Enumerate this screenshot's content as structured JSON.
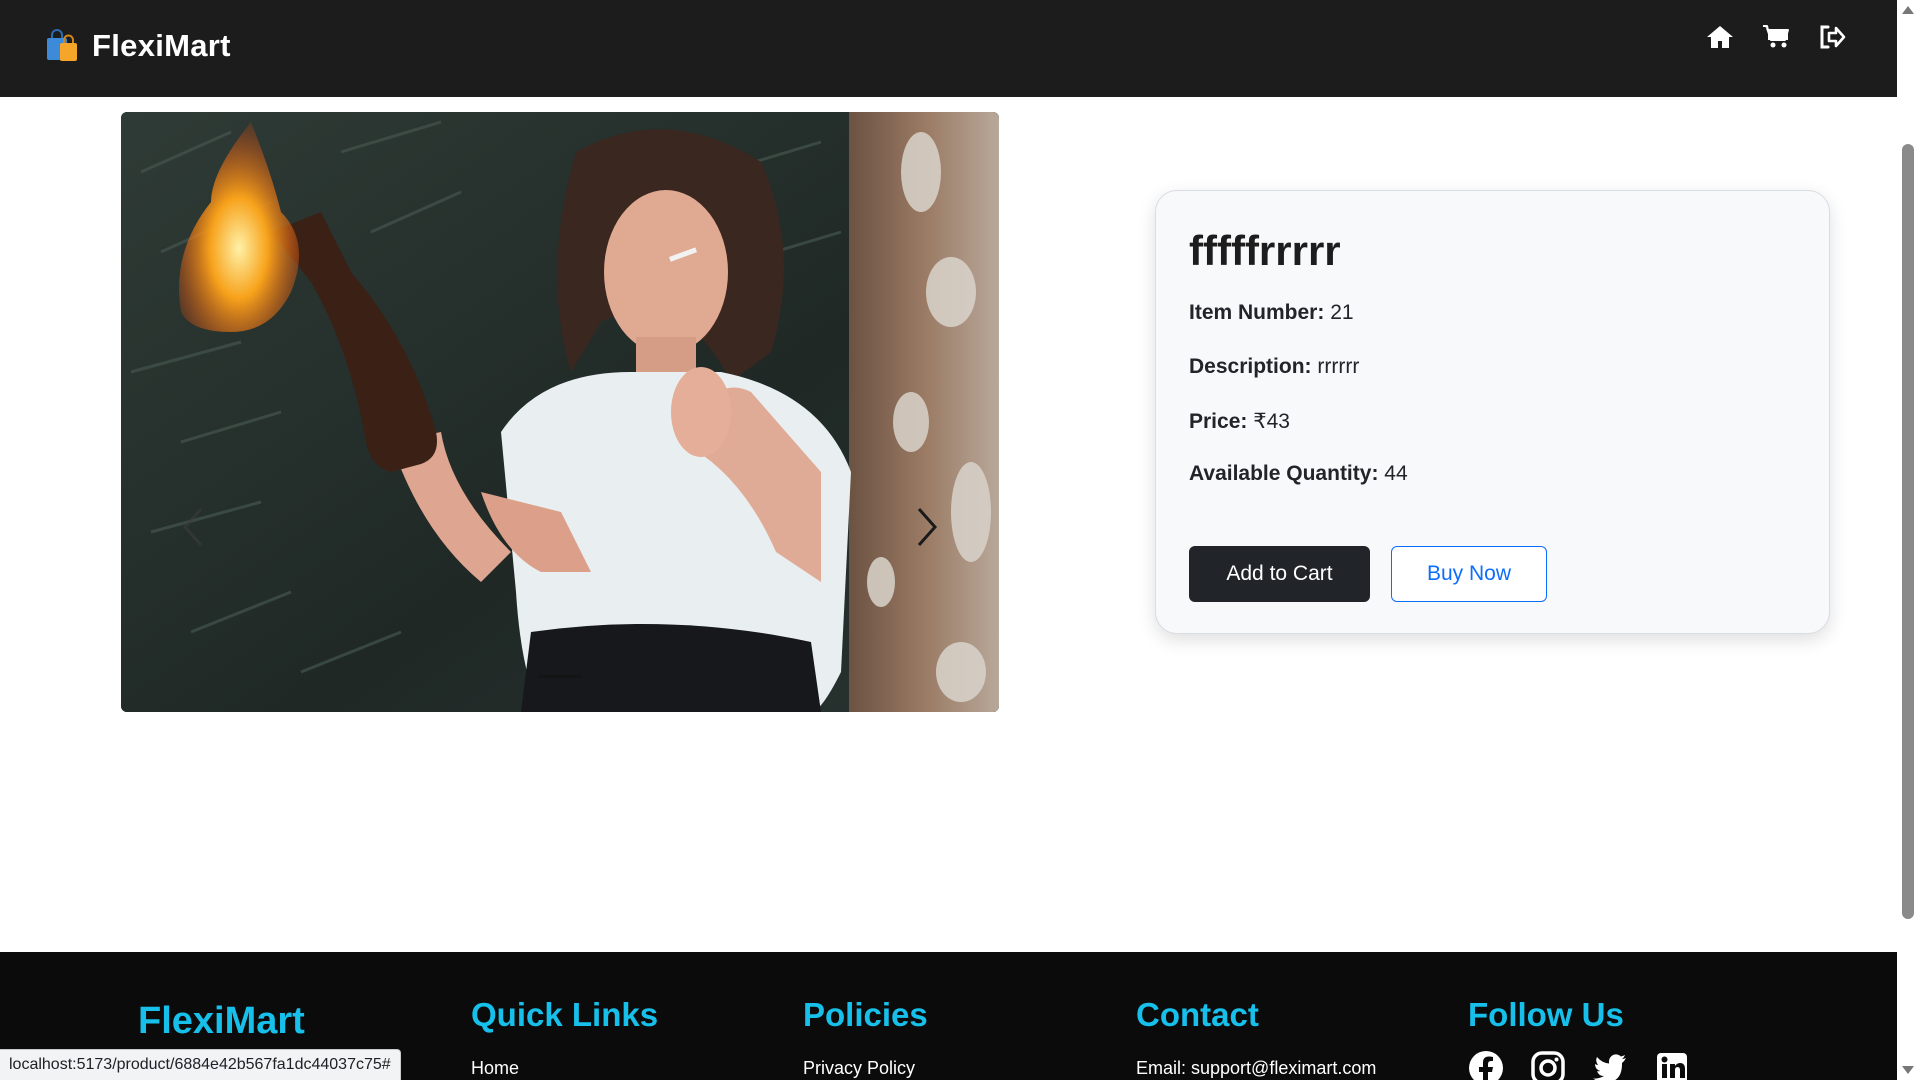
{
  "navbar": {
    "brand": "FlexiMart",
    "icons": [
      "home-icon",
      "cart-icon",
      "logout-icon"
    ]
  },
  "carousel": {
    "image_alt": "woman-holding-burning-bottle-photo",
    "active_slide": 1
  },
  "product": {
    "title": "fffffrrrrr",
    "item_number_label": "Item Number:",
    "item_number": "21",
    "description_label": "Description:",
    "description": "rrrrrr",
    "price_label": "Price:",
    "price": "₹43",
    "quantity_label": "Available Quantity:",
    "quantity": "44",
    "add_to_cart": "Add to Cart",
    "buy_now": "Buy Now"
  },
  "footer": {
    "brand": "FlexiMart",
    "quick_links_title": "Quick Links",
    "quick_links": [
      "Home"
    ],
    "policies_title": "Policies",
    "policies": [
      "Privacy Policy"
    ],
    "contact_title": "Contact",
    "contact_email": "Email: support@fleximart.com",
    "follow_title": "Follow Us",
    "socials": [
      "facebook-icon",
      "instagram-icon",
      "twitter-icon",
      "linkedin-icon"
    ]
  },
  "status_url": "localhost:5173/product/6884e42b567fa1dc44037c75#",
  "colors": {
    "navbar_bg": "#1c1c1c",
    "footer_bg": "#0b0b0b",
    "footer_heading": "#16c0ea",
    "primary_blue": "#0d6efd",
    "dark_button": "#212529"
  }
}
